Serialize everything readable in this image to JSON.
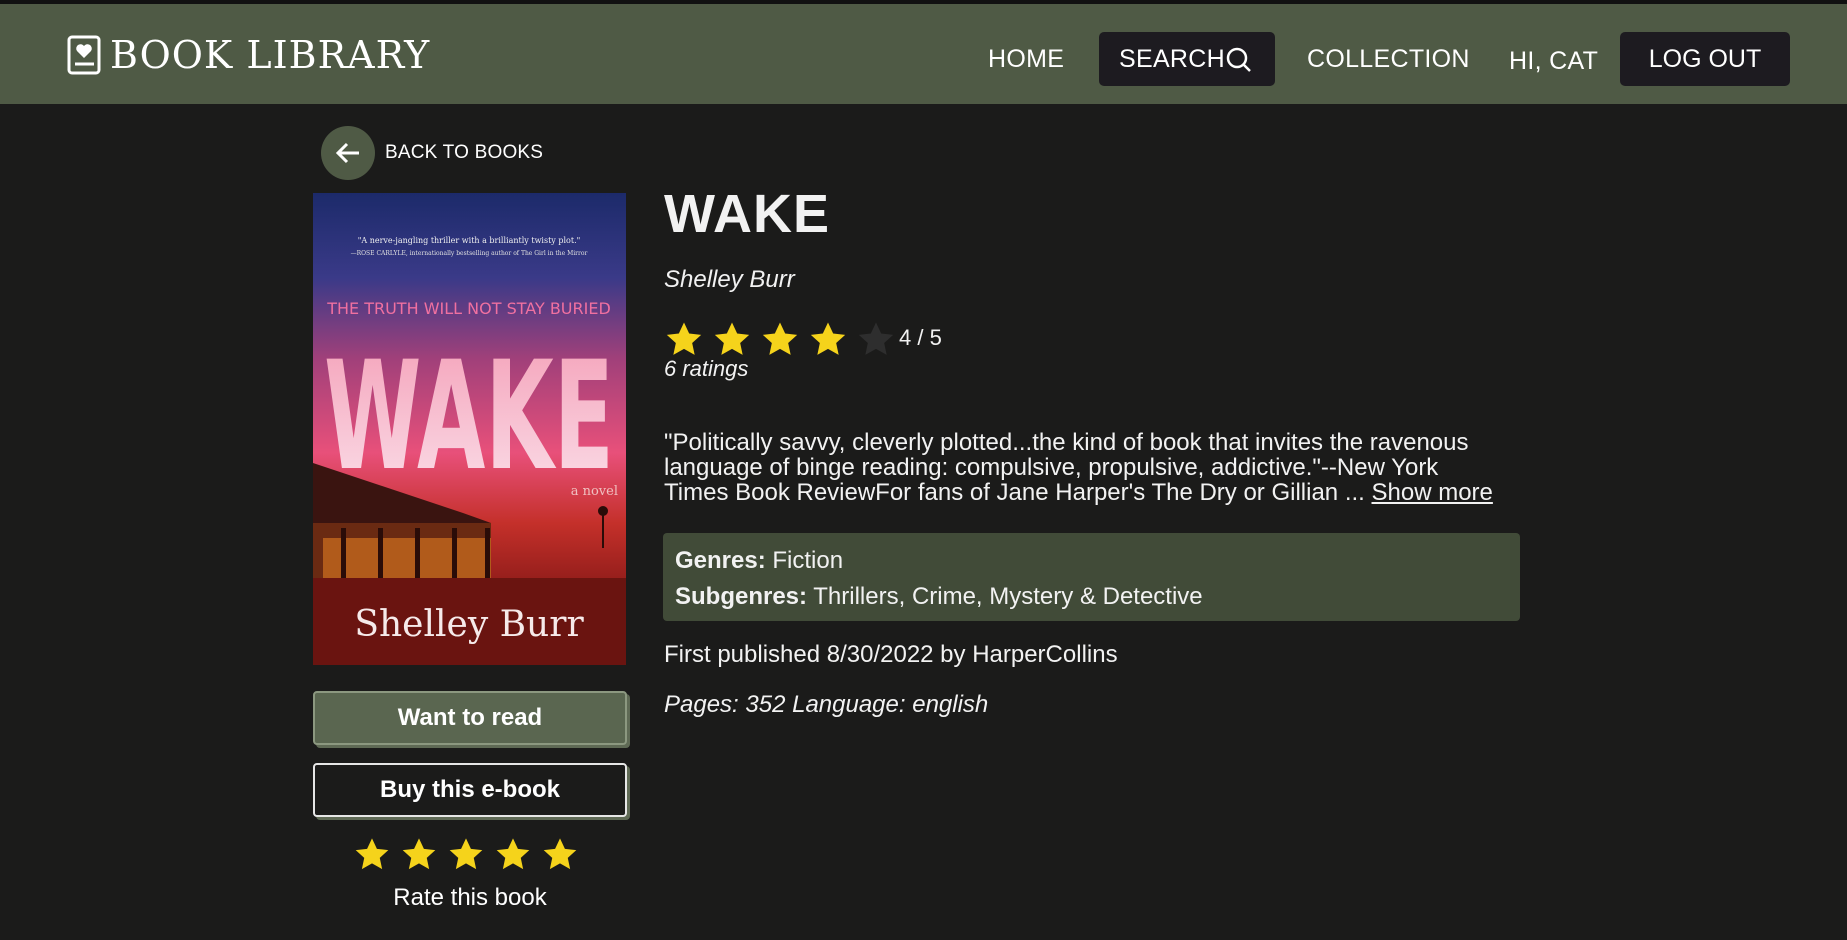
{
  "app": {
    "logo_text": "BOOK LIBRARY"
  },
  "nav": {
    "home": "HOME",
    "search": "SEARCH",
    "collection": "COLLECTION",
    "greeting": "HI, CAT",
    "logout": "LOG OUT"
  },
  "back_label": "BACK TO BOOKS",
  "cover": {
    "quote": "\"A nerve-jangling thriller with a brilliantly twisty plot.\"",
    "quote_source": "—ROSE CARLYLE, internationally bestselling author of The Girl in the Mirror",
    "tagline": "THE TRUTH WILL NOT STAY BURIED",
    "title": "WAKE",
    "subtitle": "a novel",
    "author": "Shelley Burr"
  },
  "book": {
    "title": "WAKE",
    "author": "Shelley Burr",
    "rating_value": 4,
    "rating_max": 5,
    "rating_text": "4 / 5",
    "rating_count": "6 ratings",
    "description_line1": "\"Politically savvy, cleverly plotted...the kind of book that invites the ravenous",
    "description_line2": "language of binge reading: compulsive, propulsive, addictive.\"--New York",
    "description_line3": "Times Book ReviewFor fans of Jane Harper's The Dry or Gillian ... ",
    "show_more": "Show more",
    "genres_label": "Genres:",
    "genres": "Fiction",
    "subgenres_label": "Subgenres:",
    "subgenres": "Thrillers, Crime, Mystery & Detective",
    "published": "First published 8/30/2022 by HarperCollins",
    "pages_language": "Pages: 352 Language: english"
  },
  "actions": {
    "want_to_read": "Want to read",
    "buy": "Buy this e-book",
    "rate_label": "Rate this book",
    "rate_stars": 5
  },
  "colors": {
    "header": "#4f5a45",
    "background": "#1b1b1a",
    "star": "#f5d31b",
    "star_empty": "#2e2e2e",
    "genre_box": "#414b38"
  }
}
